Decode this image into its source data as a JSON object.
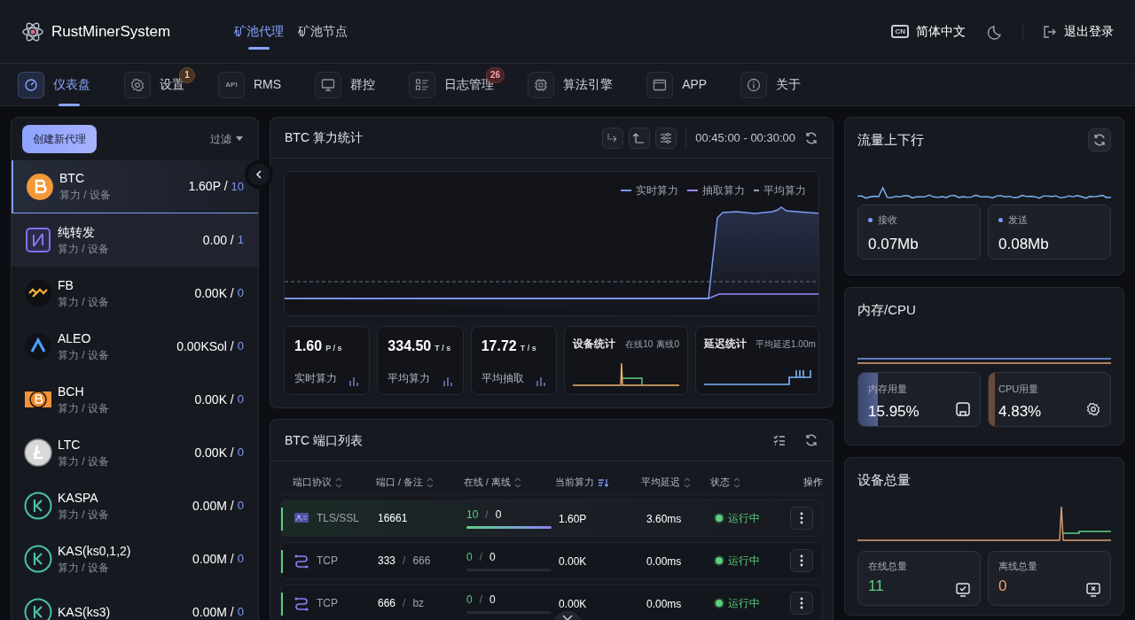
{
  "header": {
    "app_name": "RustMinerSystem",
    "top_tabs": [
      {
        "label": "矿池代理",
        "selected": true
      },
      {
        "label": "矿池节点",
        "selected": false
      }
    ],
    "language": {
      "badge": "CN",
      "label": "简体中文"
    },
    "logout": "退出登录"
  },
  "nav": [
    {
      "label": "仪表盘",
      "kind": "gauge",
      "selected": true
    },
    {
      "label": "设置",
      "kind": "gear",
      "badge": {
        "text": "1",
        "kind": "warning"
      },
      "selected": false
    },
    {
      "label": "RMS",
      "kind": "api",
      "icon_text": "API",
      "selected": false
    },
    {
      "label": "群控",
      "kind": "monitor",
      "selected": false
    },
    {
      "label": "日志管理",
      "kind": "list",
      "badge": {
        "text": "26",
        "kind": "danger"
      },
      "selected": false
    },
    {
      "label": "算法引擎",
      "kind": "chip",
      "selected": false
    },
    {
      "label": "APP",
      "kind": "window",
      "selected": false
    },
    {
      "label": "关于",
      "kind": "info",
      "selected": false
    }
  ],
  "sidebar": {
    "create_button": "创建新代理",
    "filter": "过滤",
    "coins": [
      {
        "name": "BTC",
        "sub": "算力 / 设备",
        "rate": "1.60P /",
        "devices": "10",
        "kind": "btc",
        "selected": true,
        "hovered": false
      },
      {
        "name": "纯转发",
        "sub": "算力 / 设备",
        "rate": "0.00 /",
        "devices": "1",
        "kind": "forward",
        "selected": false,
        "hovered": true
      },
      {
        "name": "FB",
        "sub": "算力 / 设备",
        "rate": "0.00K /",
        "devices": "0",
        "kind": "fb",
        "selected": false,
        "hovered": false
      },
      {
        "name": "ALEO",
        "sub": "算力 / 设备",
        "rate": "0.00KSol /",
        "devices": "0",
        "kind": "aleo",
        "selected": false,
        "hovered": false
      },
      {
        "name": "BCH",
        "sub": "算力 / 设备",
        "rate": "0.00K /",
        "devices": "0",
        "kind": "bch",
        "selected": false,
        "hovered": false
      },
      {
        "name": "LTC",
        "sub": "算力 / 设备",
        "rate": "0.00K /",
        "devices": "0",
        "kind": "ltc",
        "selected": false,
        "hovered": false
      },
      {
        "name": "KASPA",
        "sub": "算力 / 设备",
        "rate": "0.00M /",
        "devices": "0",
        "kind": "kaspa",
        "selected": false,
        "hovered": false
      },
      {
        "name": "KAS(ks0,1,2)",
        "sub": "算力 / 设备",
        "rate": "0.00M /",
        "devices": "0",
        "kind": "kaspa",
        "selected": false,
        "hovered": false
      },
      {
        "name": "KAS(ks3)",
        "rate": "0.00M /",
        "devices": "0",
        "kind": "kaspa",
        "selected": false,
        "hovered": false
      }
    ]
  },
  "hashrate": {
    "title": "BTC 算力统计",
    "time_range": "00:45:00 - 00:30:00",
    "legend": [
      {
        "label": "实时算力",
        "color": "#7c9cf5",
        "kind": "line"
      },
      {
        "label": "抽取算力",
        "color": "#9b8cf5",
        "kind": "line"
      },
      {
        "label": "平均算力",
        "color": "#9ca3af",
        "kind": "dash"
      }
    ],
    "stats": [
      {
        "value": "1.60",
        "unit": "P / s",
        "label": "实时算力"
      },
      {
        "value": "334.50",
        "unit": "T / s",
        "label": "平均算力"
      },
      {
        "value": "17.72",
        "unit": "T / s",
        "label": "平均抽取"
      }
    ],
    "device_stats": {
      "title": "设备统计",
      "online_label": "在线",
      "online": "10",
      "offline_label": "离线",
      "offline": "0"
    },
    "latency": {
      "title": "延迟统计",
      "summary": "平均延迟1.00m"
    }
  },
  "ports": {
    "title": "BTC 端口列表",
    "columns": [
      {
        "label": "端口协议",
        "sortable": true,
        "sorted": false
      },
      {
        "label": "端口 / 备注",
        "sortable": true,
        "sorted": false
      },
      {
        "label": "在线 / 离线",
        "sortable": true,
        "sorted": false
      },
      {
        "label": "当前算力",
        "sortable": true,
        "sorted": true
      },
      {
        "label": "平均延迟",
        "sortable": true,
        "sorted": false
      },
      {
        "label": "状态",
        "sortable": true,
        "sorted": false
      },
      {
        "label": "操作",
        "sortable": false
      }
    ],
    "rows": [
      {
        "protocol": "TLS/SSL",
        "kind": "tls",
        "port": "16661",
        "online": "10",
        "count_separator": "/",
        "offline": "0",
        "level": 1,
        "hashrate": "1.60P",
        "latency": "3.60ms",
        "status": "运行中",
        "selected": true
      },
      {
        "protocol": "TCP",
        "kind": "tcp",
        "port": "333",
        "note_separator": "/",
        "note": "666",
        "online": "0",
        "count_separator": "/",
        "offline": "0",
        "level": 0,
        "hashrate": "0.00K",
        "latency": "0.00ms",
        "status": "运行中",
        "selected": false
      },
      {
        "protocol": "TCP",
        "kind": "tcp",
        "port": "666",
        "note_separator": "/",
        "note": "bz",
        "online": "0",
        "count_separator": "/",
        "offline": "0",
        "level": 0,
        "hashrate": "0.00K",
        "latency": "0.00ms",
        "status": "运行中",
        "selected": false
      }
    ]
  },
  "traffic": {
    "title": "流量上下行",
    "receive": {
      "label": "接收",
      "value": "0.07Mb",
      "color": "#7c9cf5"
    },
    "send": {
      "label": "发送",
      "value": "0.08Mb",
      "color": "#7c9cf5"
    }
  },
  "resources": {
    "title": "内存/CPU",
    "memory": {
      "label": "内存用量",
      "value": "15.95%",
      "level": 0.16
    },
    "cpu": {
      "label": "CPU用量",
      "value": "4.83%",
      "level": 0.05
    }
  },
  "devices": {
    "title": "设备总量",
    "online": {
      "label": "在线总量",
      "value": "11"
    },
    "offline": {
      "label": "离线总量",
      "value": "0"
    }
  }
}
